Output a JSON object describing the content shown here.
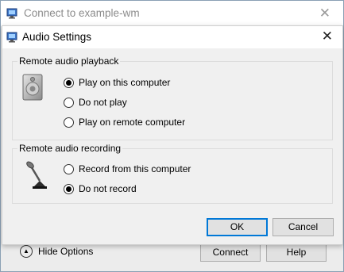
{
  "background_window": {
    "title": "Connect to example-wm",
    "close_glyph": "✕",
    "hide_options_label": "Hide Options",
    "connect_label": "Connect",
    "help_label": "Help"
  },
  "dialog": {
    "title": "Audio Settings",
    "close_glyph": "✕",
    "playback": {
      "label": "Remote audio playback",
      "icon": "speaker-icon",
      "options": [
        {
          "label": "Play on this computer",
          "checked": true
        },
        {
          "label": "Do not play",
          "checked": false
        },
        {
          "label": "Play on remote computer",
          "checked": false
        }
      ]
    },
    "recording": {
      "label": "Remote audio recording",
      "icon": "microphone-icon",
      "options": [
        {
          "label": "Record from this computer",
          "checked": false
        },
        {
          "label": "Do not record",
          "checked": true
        }
      ]
    },
    "ok_label": "OK",
    "cancel_label": "Cancel"
  },
  "colors": {
    "accent": "#0078d7",
    "desktop": "#6f8fa7"
  }
}
